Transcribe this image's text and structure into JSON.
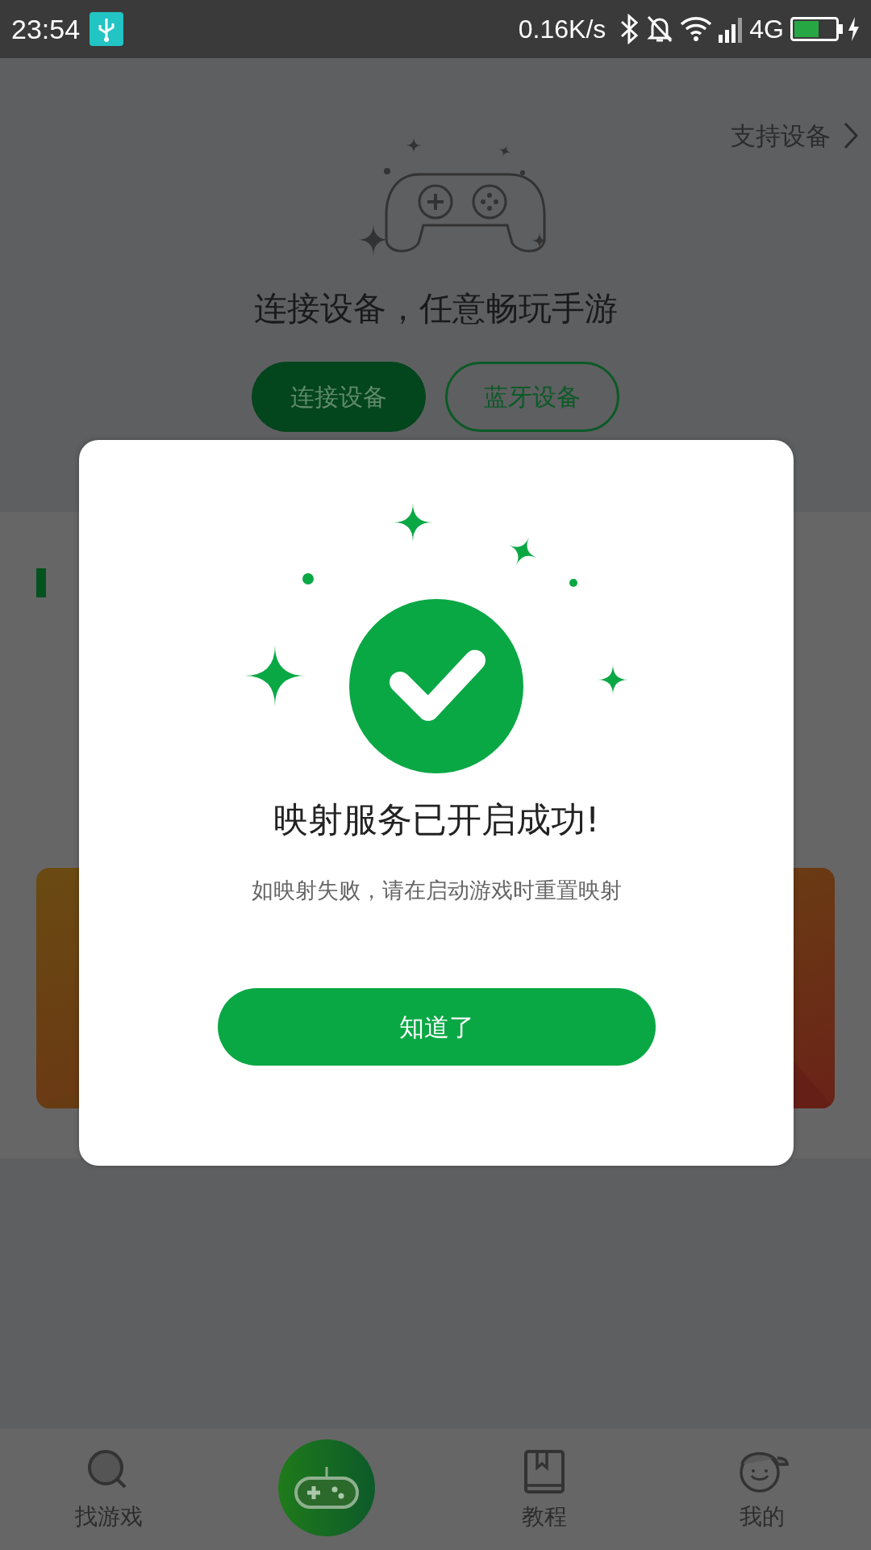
{
  "status_bar": {
    "time": "23:54",
    "net_speed": "0.16K/s",
    "network": "4G"
  },
  "header": {
    "link": "支持设备",
    "headline": "连接设备，任意畅玩手游",
    "buttons": [
      {
        "label": "连接设备",
        "kind": "filled"
      },
      {
        "label": "蓝牙设备",
        "kind": "outline"
      }
    ]
  },
  "dialog": {
    "title": "映射服务已开启成功!",
    "message": "如映射失败，请在启动游戏时重置映射",
    "button": "知道了"
  },
  "bottom_nav": [
    {
      "label": "找游戏",
      "kind": "search",
      "selected": false
    },
    {
      "kind": "gamepad",
      "selected": true
    },
    {
      "label": "教程",
      "kind": "book",
      "selected": false
    },
    {
      "label": "我的",
      "kind": "avatar",
      "selected": false
    }
  ]
}
